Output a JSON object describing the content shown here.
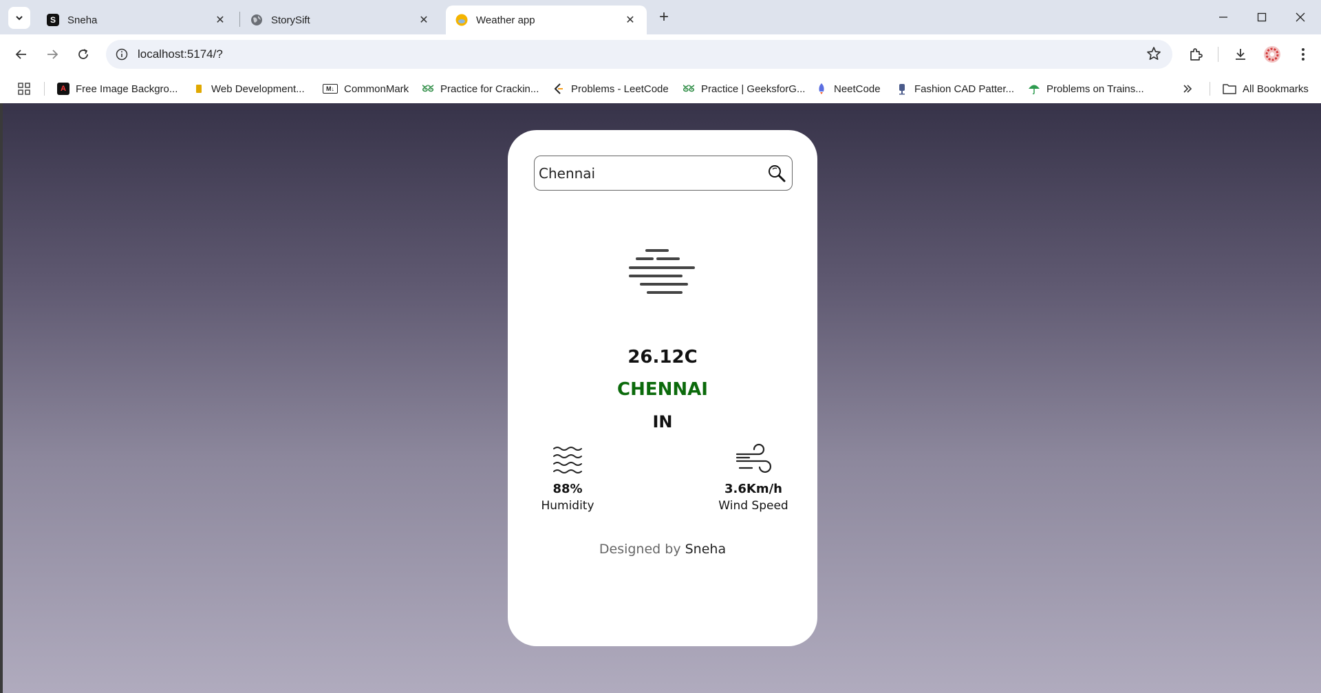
{
  "browser": {
    "tabs": [
      {
        "title": "Sneha",
        "favicon": "S",
        "active": false
      },
      {
        "title": "StorySift",
        "favicon": "globe-icon",
        "active": false
      },
      {
        "title": "Weather app",
        "favicon": "weather-app-icon",
        "active": true
      }
    ],
    "url": "localhost:5174/?",
    "bookmarks": [
      {
        "label": "Free Image Backgro...",
        "icon": "adobe-icon"
      },
      {
        "label": "Web Development...",
        "icon": "bookmark-icon"
      },
      {
        "label": "CommonMark",
        "icon": "M↓"
      },
      {
        "label": "Practice for Crackin...",
        "icon": "gfg-icon"
      },
      {
        "label": "Problems - LeetCode",
        "icon": "leetcode-icon"
      },
      {
        "label": "Practice | GeeksforG...",
        "icon": "gfg-icon"
      },
      {
        "label": "NeetCode",
        "icon": "rocket-icon"
      },
      {
        "label": "Fashion CAD Patter...",
        "icon": "mannequin-icon"
      },
      {
        "label": "Problems on Trains...",
        "icon": "umbrella-icon"
      }
    ],
    "all_bookmarks_label": "All Bookmarks"
  },
  "weather": {
    "search_value": "Chennai",
    "condition_icon": "mist-icon",
    "temperature": "26.12C",
    "city": "CHENNAI",
    "country": "IN",
    "humidity": {
      "value": "88%",
      "label": "Humidity"
    },
    "wind": {
      "value": "3.6Km/h",
      "label": "Wind Speed"
    },
    "credit_prefix": "Designed by",
    "credit_name": "Sneha"
  },
  "colors": {
    "city_text": "#0b6a0b",
    "tabstrip_bg": "#dee3ed",
    "omnibox_bg": "#eef1f8"
  }
}
